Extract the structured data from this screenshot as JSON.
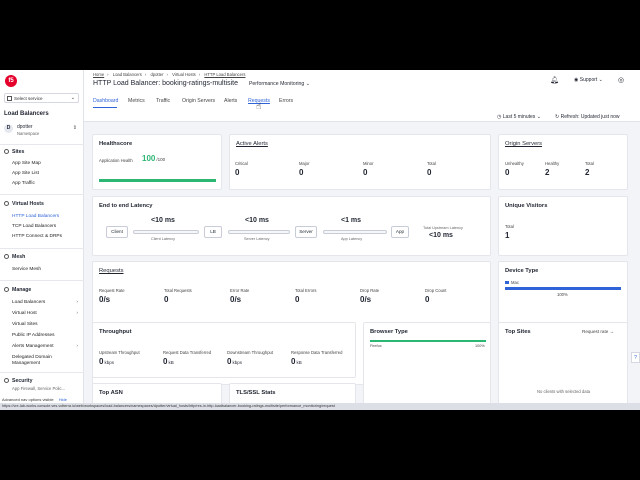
{
  "app": {
    "logo_text": "f5"
  },
  "sidebar": {
    "select_service": "Select service",
    "title": "Load Balancers",
    "namespace": {
      "avatar": "D",
      "name": "dpotter",
      "label": "Namespace"
    },
    "sections": [
      {
        "title": "Sites",
        "items": [
          "App Site Map",
          "App Site List",
          "App Traffic"
        ]
      },
      {
        "title": "Virtual Hosts",
        "items": [
          "HTTP Load Balancers",
          "TCP Load Balancers",
          "HTTP Connect & DRPs"
        ]
      },
      {
        "title": "Mesh",
        "items": [
          "Service Mesh"
        ]
      },
      {
        "title": "Manage",
        "items": [
          "Load Balancers",
          "Virtual Host",
          "Virtual Sites",
          "Public IP Addresses",
          "Alerts Management",
          "Delegated Domain Management"
        ]
      },
      {
        "title": "Security",
        "subtitle": "App Firewall, Service Polic..."
      }
    ],
    "advanced_nav": "Advanced nav options visible",
    "hide": "Hide"
  },
  "header": {
    "breadcrumbs": [
      "Home",
      "Load Balancers",
      "dpotter",
      "Virtual Hosts",
      "HTTP Load Balancers"
    ],
    "title": "HTTP Load Balancer: booking-ratings-multisite",
    "perf": "Performance Monitoring",
    "support": "Support",
    "tabs": [
      "Dashboard",
      "Metrics",
      "Traffic",
      "Origin Servers",
      "Alerts",
      "Requests",
      "Errors"
    ],
    "time_range": "Last 5 minutes",
    "refresh": "Refresh: Updated just now"
  },
  "healthscore": {
    "title": "Healthscore",
    "label": "Application Health",
    "value": "100",
    "suffix": "/100",
    "fill": 1.0
  },
  "alerts": {
    "title": "Active Alerts",
    "labels": [
      "Critical",
      "Major",
      "Minor",
      "Total"
    ],
    "values": [
      "0",
      "0",
      "0",
      "0"
    ]
  },
  "origin": {
    "title": "Origin Servers",
    "labels": [
      "Unhealthy",
      "Healthy",
      "Total"
    ],
    "values": [
      "0",
      "2",
      "2"
    ]
  },
  "latency": {
    "title": "End to end Latency",
    "nodes": [
      "Client",
      "LB",
      "Server",
      "App"
    ],
    "values": [
      "<10 ms",
      "<10 ms",
      "<1 ms"
    ],
    "labels": [
      "Client Latency",
      "Server Latency",
      "App Latency"
    ],
    "total_label": "Total Upstream Latency",
    "total_value": "<10 ms"
  },
  "visitors": {
    "title": "Unique Visitors",
    "label": "Total",
    "value": "1"
  },
  "requests": {
    "title": "Requests",
    "labels": [
      "Request Rate",
      "Total Requests",
      "Error Rate",
      "Total Errors",
      "Drop Rate",
      "Drop Count"
    ],
    "values": [
      "0/s",
      "0",
      "0/s",
      "0",
      "0/s",
      "0"
    ]
  },
  "device": {
    "title": "Device Type",
    "legend": "Mac",
    "percent": "100%",
    "fill": 1.0
  },
  "throughput": {
    "title": "Throughput",
    "labels": [
      "Upstream Throughput",
      "Request Data Transferred",
      "Downstream Throughput",
      "Response Data Transferred"
    ],
    "values": [
      "0",
      "0",
      "0",
      "0"
    ],
    "units": [
      "kbps",
      "kB",
      "kbps",
      "kB"
    ]
  },
  "browser": {
    "title": "Browser Type",
    "name": "Firefox",
    "percent": "100%",
    "fill": 1.0
  },
  "topsites": {
    "title": "Top Sites",
    "dropdown": "Request rate",
    "empty": "No clients with selected data"
  },
  "topasn": {
    "title": "Top ASN"
  },
  "tls": {
    "title": "TLS/SSL Stats"
  },
  "status_url": "https://vre-lab-works.console.ves.volterra.io/web/workspaces/load-balancers/namespaces/dpotter/virtual_hosts/http/res-in-http-loadbalancer-booking-ratings-multisite/performance_monitoring/request",
  "colors": {
    "accent": "#2f63d8",
    "good": "#2bb673",
    "brand": "#e4002b"
  }
}
